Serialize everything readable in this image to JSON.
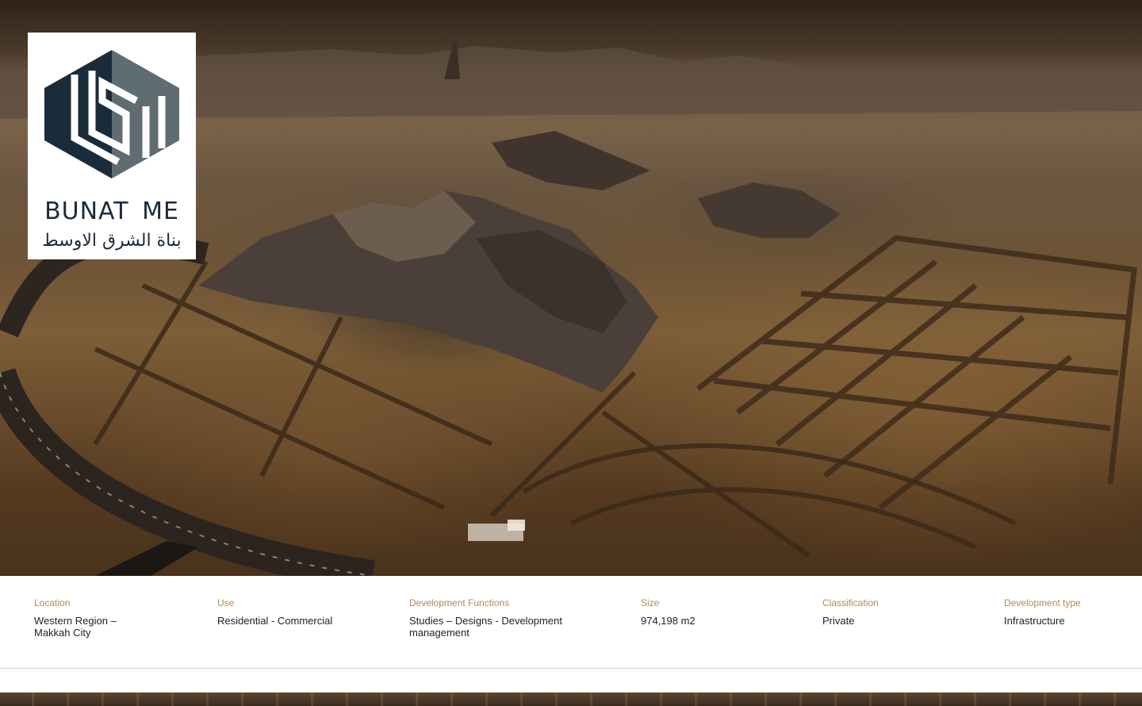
{
  "logo": {
    "name_en": "BUNAT  ME",
    "name_ar": "بناة الشرق الاوسط",
    "colors": {
      "dark": "#1a2b3a",
      "grey": "#5f6c72"
    }
  },
  "hero": {
    "alt": "Aerial view of desert land development with mountains"
  },
  "details": [
    {
      "label": "Location",
      "value": "Western Region –\nMakkah City"
    },
    {
      "label": "Use",
      "value": "Residential - Commercial"
    },
    {
      "label": "Development Functions",
      "value": "Studies – Designs - Development\nmanagement"
    },
    {
      "label": "Size",
      "value": "974,198 m2"
    },
    {
      "label": "Classification",
      "value": "Private"
    },
    {
      "label": "Development type",
      "value": "Infrastructure"
    }
  ],
  "colors": {
    "label": "#b08a5a",
    "value": "#222222",
    "divider": "#d8cfc2"
  }
}
